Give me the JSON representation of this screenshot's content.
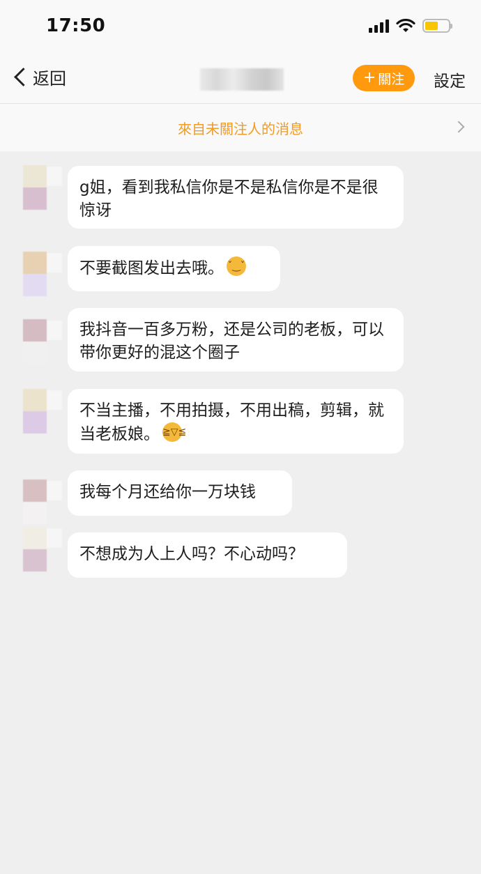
{
  "status_bar": {
    "time": "17:50"
  },
  "nav": {
    "back_label": "返回",
    "follow_plus": "+",
    "follow_label": "關注",
    "settings_label": "設定"
  },
  "notice": {
    "text": "來自未關注人的消息"
  },
  "colors": {
    "accent": "#ff9a0e",
    "notice_text": "#f29a23",
    "background": "#efefef",
    "bubble": "#ffffff"
  },
  "messages": [
    {
      "text": "g姐，看到我私信你是不是私信你是不是很惊讶"
    },
    {
      "text": "不要截图发出去哦。",
      "emoji": "smirk-emoji"
    },
    {
      "text": "我抖音一百多万粉，还是公司的老板，可以带你更好的混这个圈子"
    },
    {
      "text": "不当主播，不用拍摄，不用出稿，剪辑，就当老板娘。",
      "emoji": "grin-emoji"
    },
    {
      "text": "我每个月还给你一万块钱"
    },
    {
      "text": "不想成为人上人吗？不心动吗？"
    }
  ]
}
